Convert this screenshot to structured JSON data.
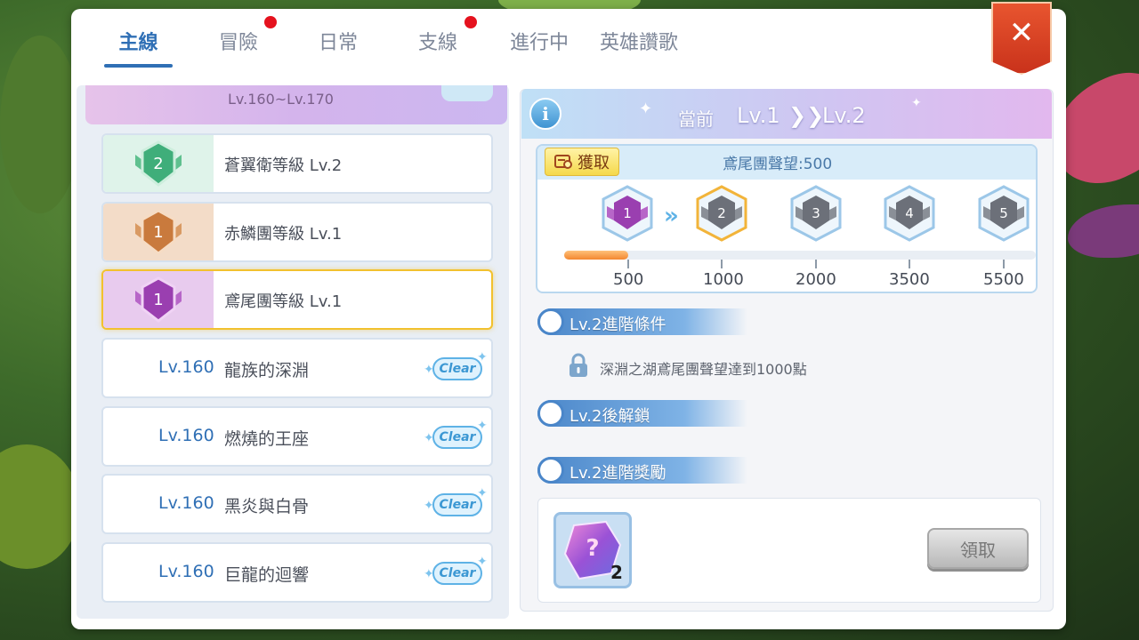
{
  "tabs": [
    {
      "label": "主線",
      "active": true,
      "has_dot": false
    },
    {
      "label": "冒險",
      "active": false,
      "has_dot": true
    },
    {
      "label": "日常",
      "active": false,
      "has_dot": false
    },
    {
      "label": "支線",
      "active": false,
      "has_dot": true
    },
    {
      "label": "進行中",
      "active": false,
      "has_dot": false
    },
    {
      "label": "英雄讚歌",
      "active": false,
      "has_dot": false
    }
  ],
  "close_label": "✕",
  "left_list": {
    "group_header": "Lv.160~Lv.170",
    "ranks": [
      {
        "badge": "2",
        "title": "蒼翼衛等級 Lv.2",
        "color": "#3fae7a",
        "bg": "#dff3ea",
        "selected": false
      },
      {
        "badge": "1",
        "title": "赤鱗團等級 Lv.1",
        "color": "#c97a3d",
        "bg": "#f3dcc8",
        "selected": false
      },
      {
        "badge": "1",
        "title": "鳶尾團等級 Lv.1",
        "color": "#9a3fb0",
        "bg": "#e8cbee",
        "selected": true
      }
    ],
    "quests": [
      {
        "level": "Lv.160",
        "name": "龍族的深淵",
        "status": "Clear"
      },
      {
        "level": "Lv.160",
        "name": "燃燒的王座",
        "status": "Clear"
      },
      {
        "level": "Lv.160",
        "name": "黑炎與白骨",
        "status": "Clear"
      },
      {
        "level": "Lv.160",
        "name": "巨龍的迴響",
        "status": "Clear"
      }
    ]
  },
  "detail": {
    "info_icon": "i",
    "header": {
      "current_label": "當前",
      "from_level": "Lv.1",
      "to_level": "Lv.2"
    },
    "obtain_button": "獲取",
    "reputation_label": "鳶尾團聲望:500",
    "reputation_value": 500,
    "rank_badges": [
      "1",
      "2",
      "3",
      "4",
      "5"
    ],
    "milestones": [
      "500",
      "1000",
      "2000",
      "3500",
      "5500"
    ],
    "sections": {
      "condition_title": "Lv.2進階條件",
      "condition_text": "深淵之湖鳶尾團聲望達到1000點",
      "unlock_title": "Lv.2後解鎖",
      "reward_title": "Lv.2進階獎勵"
    },
    "reward": {
      "icon": "mystery-crystal-icon",
      "quantity": "2"
    },
    "claim_button": "領取"
  },
  "colors": {
    "accent": "#2f6fb5",
    "red_dot": "#e5121e",
    "close_button": "#d43d22",
    "progress": "#f3872f"
  }
}
